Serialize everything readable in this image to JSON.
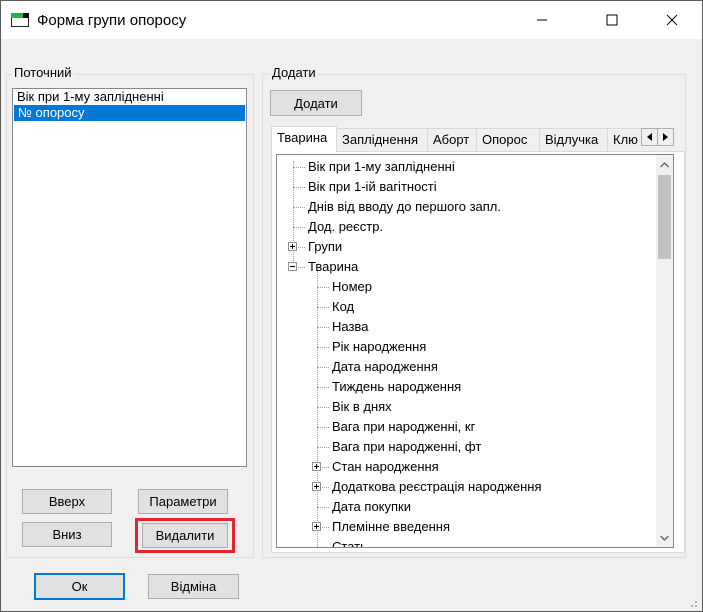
{
  "window": {
    "title": "Форма групи опоросу",
    "controls": {
      "minimize": "minimize",
      "maximize": "maximize",
      "close": "close"
    }
  },
  "current": {
    "legend": "Поточний",
    "items": [
      {
        "label": "Вік при 1-му заплідненні",
        "selected": false
      },
      {
        "label": "№ опоросу",
        "selected": true
      }
    ],
    "buttons": {
      "up": "Вверх",
      "params": "Параметри",
      "down": "Вниз",
      "delete": "Видалити"
    }
  },
  "add": {
    "legend": "Додати",
    "add_button": "Додати",
    "tabs": [
      {
        "label": "Тварина",
        "active": true
      },
      {
        "label": "Запліднення",
        "active": false
      },
      {
        "label": "Аборт",
        "active": false
      },
      {
        "label": "Опорос",
        "active": false
      },
      {
        "label": "Відлучка",
        "active": false
      },
      {
        "label": "Клю",
        "active": false
      }
    ],
    "tree": [
      {
        "label": "Вік при 1-му заплідненні",
        "level": 0,
        "expander": "none"
      },
      {
        "label": "Вік при 1-ій вагітності",
        "level": 0,
        "expander": "none"
      },
      {
        "label": "Днів від вводу до першого запл.",
        "level": 0,
        "expander": "none"
      },
      {
        "label": "Дод. реєстр.",
        "level": 0,
        "expander": "none"
      },
      {
        "label": "Групи",
        "level": 0,
        "expander": "plus"
      },
      {
        "label": "Тварина",
        "level": 0,
        "expander": "minus"
      },
      {
        "label": "Номер",
        "level": 1,
        "expander": "none"
      },
      {
        "label": "Код",
        "level": 1,
        "expander": "none"
      },
      {
        "label": "Назва",
        "level": 1,
        "expander": "none"
      },
      {
        "label": "Рік народження",
        "level": 1,
        "expander": "none"
      },
      {
        "label": "Дата народження",
        "level": 1,
        "expander": "none"
      },
      {
        "label": "Тиждень народження",
        "level": 1,
        "expander": "none"
      },
      {
        "label": "Вік в днях",
        "level": 1,
        "expander": "none"
      },
      {
        "label": "Вага при народженні, кг",
        "level": 1,
        "expander": "none"
      },
      {
        "label": "Вага при народженні, фт",
        "level": 1,
        "expander": "none"
      },
      {
        "label": "Стан народження",
        "level": 1,
        "expander": "plus"
      },
      {
        "label": "Додаткова реєстрація народження",
        "level": 1,
        "expander": "plus"
      },
      {
        "label": "Дата покупки",
        "level": 1,
        "expander": "none"
      },
      {
        "label": "Племінне введення",
        "level": 1,
        "expander": "plus"
      },
      {
        "label": "Стать",
        "level": 1,
        "expander": "none"
      }
    ]
  },
  "footer": {
    "ok": "Ок",
    "cancel": "Відміна"
  },
  "colors": {
    "accent": "#0078d7",
    "highlight": "#e3262b"
  }
}
